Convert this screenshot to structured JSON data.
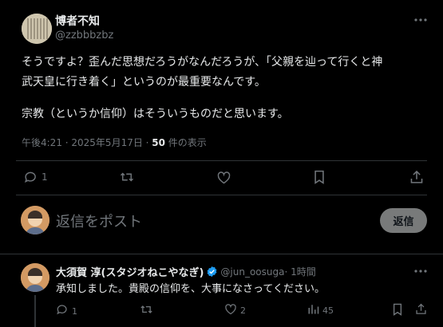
{
  "post": {
    "display_name": "博者不知",
    "handle": "@zzbbbzbz",
    "text_line1": "そうですよ？歪んだ思想だろうがなんだろうが、「父親を辿って行くと神",
    "text_line2": "武天皇に行き着く」というのが最重要なんです。",
    "text_line3": "宗教（というか信仰）はそういうものだと思います。",
    "timestamp": "午後4:21 · 2025年5月17日 · ",
    "view_count": "50",
    "view_suffix": " 件の表示",
    "reply_count": "1"
  },
  "composer": {
    "placeholder": "返信をポスト",
    "reply_button": "返信"
  },
  "reply": {
    "display_name": "大須賀 淳(スタジオねこやなぎ)",
    "handle": "@jun_oosuga",
    "time": " · 1時間",
    "text": "承知しました。貴殿の信仰を、大事になさってください。",
    "reply_count": "1",
    "like_count": "2",
    "view_count": "45"
  },
  "icons": {
    "more": "more-horizontal-icon",
    "verified": "verified-badge-icon",
    "reply": "reply-icon",
    "retweet": "retweet-icon",
    "like": "like-icon",
    "bookmark": "bookmark-icon",
    "share": "share-icon",
    "views": "views-icon"
  },
  "colors": {
    "background": "#000000",
    "text": "#e7e9ea",
    "muted": "#71767b",
    "verified": "#1d9bf0",
    "button_bg": "#787a7a"
  }
}
